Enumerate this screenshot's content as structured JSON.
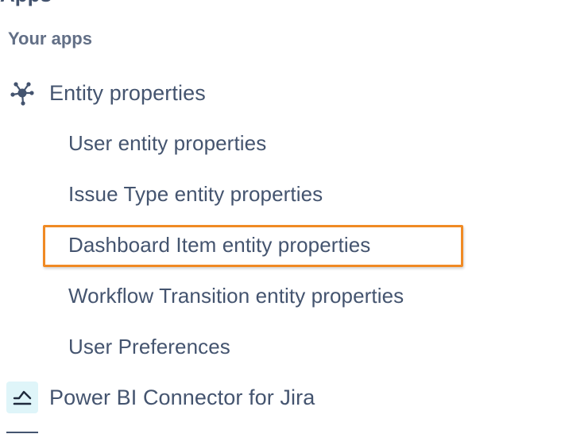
{
  "section": {
    "heading_partial": "Apps",
    "label": "Your apps"
  },
  "apps": [
    {
      "title": "Entity properties",
      "icon": "network-nodes-icon",
      "items": [
        {
          "label": "User entity properties"
        },
        {
          "label": "Issue Type entity properties"
        },
        {
          "label": "Dashboard Item entity properties",
          "highlighted": true
        },
        {
          "label": "Workflow Transition entity properties"
        },
        {
          "label": "User Preferences"
        }
      ]
    },
    {
      "title": "Power BI Connector for Jira",
      "icon": "power-bi-connector-icon"
    }
  ],
  "colors": {
    "text": "#44546f",
    "section_label": "#626f86",
    "highlight": "#f08a24",
    "icon_bg": "#dff5f9"
  }
}
